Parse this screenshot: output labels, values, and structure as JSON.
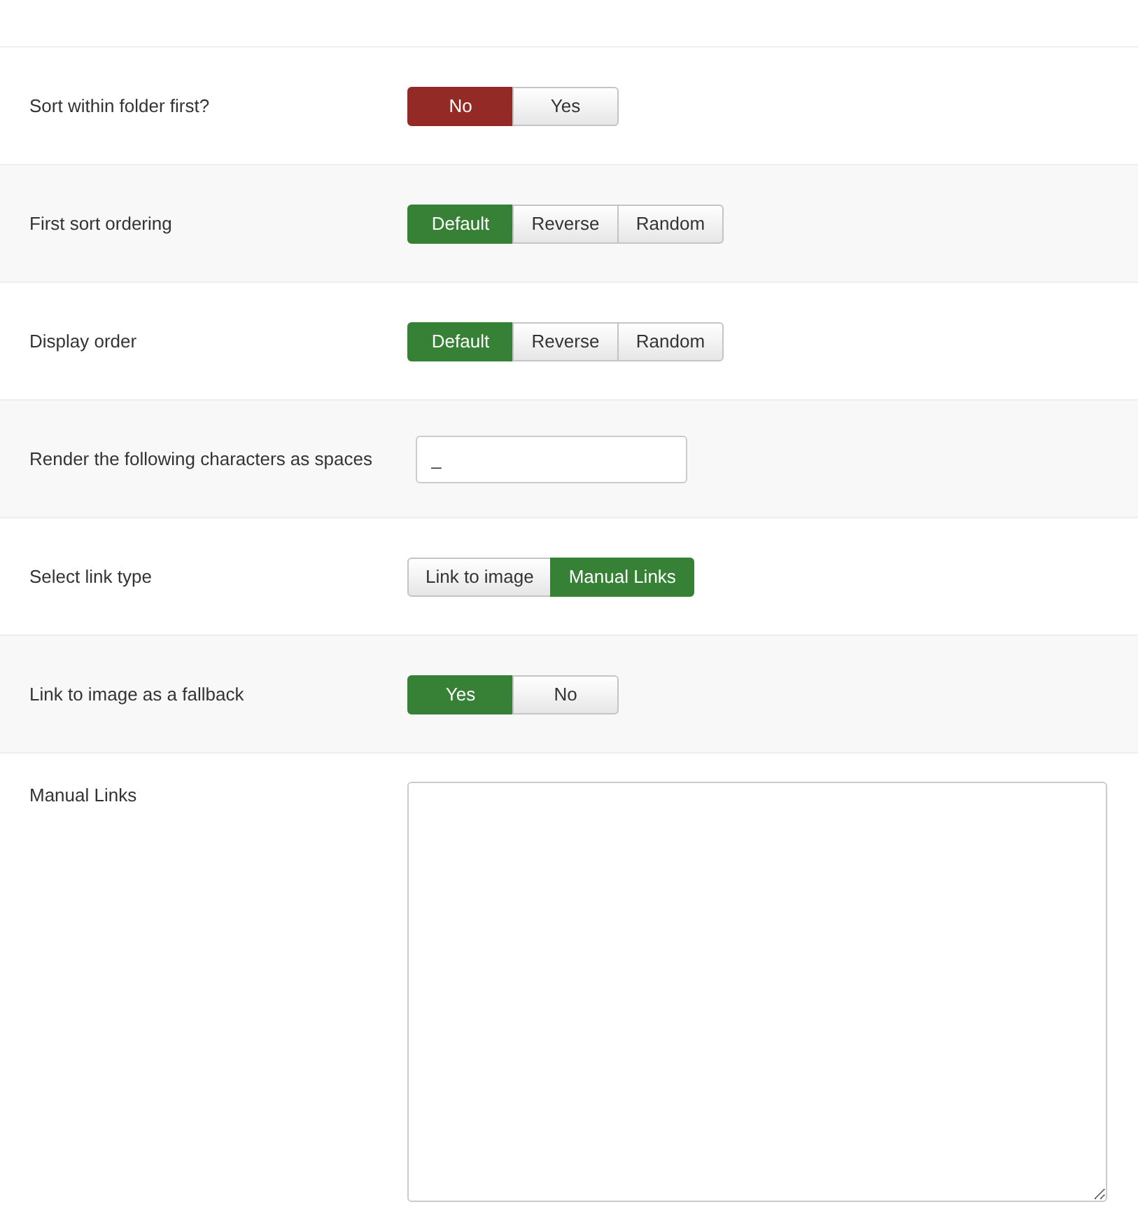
{
  "rows": [
    {
      "kind": "toggle",
      "label": "Sort within folder first?",
      "options": [
        {
          "label": "No",
          "selected": true,
          "color": "#942a25"
        },
        {
          "label": "Yes",
          "selected": false
        }
      ]
    },
    {
      "kind": "toggle",
      "label": "First sort ordering",
      "options": [
        {
          "label": "Default",
          "selected": true,
          "color": "#378137"
        },
        {
          "label": "Reverse",
          "selected": false
        },
        {
          "label": "Random",
          "selected": false
        }
      ]
    },
    {
      "kind": "toggle",
      "label": "Display order",
      "options": [
        {
          "label": "Default",
          "selected": true,
          "color": "#378137"
        },
        {
          "label": "Reverse",
          "selected": false
        },
        {
          "label": "Random",
          "selected": false
        }
      ]
    },
    {
      "kind": "input",
      "label": "Render the following characters as spaces",
      "value": "_"
    },
    {
      "kind": "toggle",
      "label": "Select link type",
      "options": [
        {
          "label": "Link to image",
          "selected": false
        },
        {
          "label": "Manual Links",
          "selected": true,
          "color": "#378137"
        }
      ]
    },
    {
      "kind": "toggle",
      "label": "Link to image as a fallback",
      "options": [
        {
          "label": "Yes",
          "selected": true,
          "color": "#378137"
        },
        {
          "label": "No",
          "selected": false
        }
      ]
    },
    {
      "kind": "textarea",
      "label": "Manual Links"
    }
  ]
}
